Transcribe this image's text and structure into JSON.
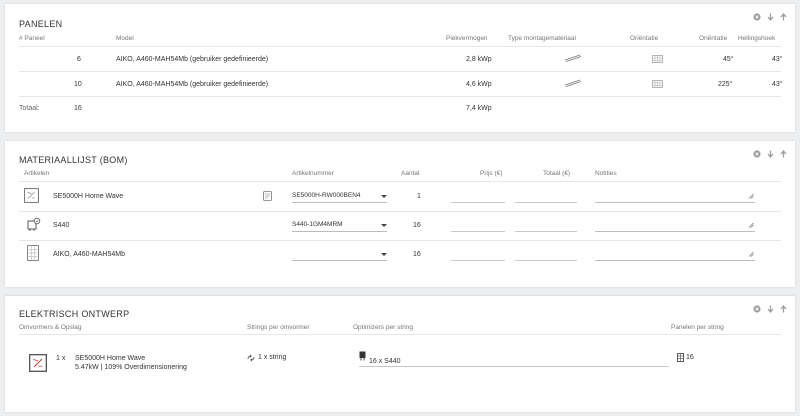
{
  "panels": {
    "title": "PANELEN",
    "headers": {
      "num": "# Paneel",
      "model": "Model",
      "power": "Piekvermogen",
      "mount": "Type montagemateriaal",
      "orient_icon": "Oriëntatie",
      "orient": "Oriëntatie",
      "tilt": "Hellingshoek"
    },
    "rows": [
      {
        "num": "6",
        "model": "AIKO, A460-MAH54Mb (gebruiker gedefinieerde)",
        "power": "2,8 kWp",
        "orientation": "45°",
        "tilt": "43°"
      },
      {
        "num": "10",
        "model": "AIKO, A460-MAH54Mb (gebruiker gedefinieerde)",
        "power": "4,6 kWp",
        "orientation": "225°",
        "tilt": "43°"
      }
    ],
    "total_label": "Totaal:",
    "total_num": "16",
    "total_power": "7,4 kWp"
  },
  "bom": {
    "title": "MATERIAALLIJST (BOM)",
    "headers": {
      "items": "Artikelen",
      "article": "Artikelnummer",
      "qty": "Aantal",
      "price": "Prijs (€)",
      "total": "Totaal (€)",
      "notes": "Notities"
    },
    "rows": [
      {
        "name": "SE5000H Home Wave",
        "article": "SE5000H-RW000BEN4",
        "qty": "1"
      },
      {
        "name": "S440",
        "article": "S440-1GM4MRM",
        "qty": "16"
      },
      {
        "name": "AIKO, A460-MAH54Mb",
        "article": "",
        "qty": "16"
      }
    ]
  },
  "electrical": {
    "title": "ELEKTRISCH ONTWERP",
    "headers": {
      "inverters": "Omvormers & Opslag",
      "strings": "Strings per omvormer",
      "optimizers": "Optimizers per string",
      "panels": "Panelen per string"
    },
    "row": {
      "count": "1 x",
      "name": "SE5000H Home Wave",
      "detail": "5.47kW | 109% Overdimensionering",
      "strings": "1 x string",
      "optimizers": "16 x S440",
      "panels": "16"
    }
  }
}
